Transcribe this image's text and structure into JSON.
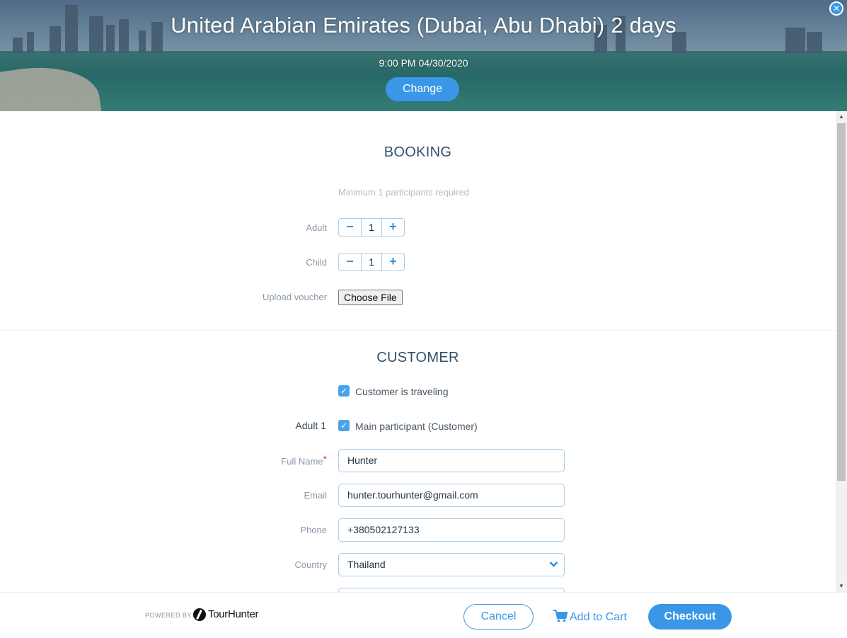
{
  "header": {
    "title": "United Arabian Emirates (Dubai, Abu Dhabi) 2 days",
    "datetime": "9:00 PM 04/30/2020",
    "change_label": "Change"
  },
  "booking": {
    "section_title": "BOOKING",
    "hint": "Minimum 1 participants required",
    "adult": {
      "label": "Adult",
      "value": "1",
      "minus": "−",
      "plus": "+"
    },
    "child": {
      "label": "Child",
      "value": "1",
      "minus": "−",
      "plus": "+"
    },
    "voucher": {
      "label": "Upload voucher",
      "button": "Choose File"
    }
  },
  "customer": {
    "section_title": "CUSTOMER",
    "traveling_label": "Customer is traveling",
    "traveling_checked": true,
    "participant_label": "Adult 1",
    "main_participant_label": "Main participant (Customer)",
    "main_participant_checked": true,
    "fields": {
      "full_name": {
        "label": "Full Name",
        "value": "Hunter",
        "required_mark": "*"
      },
      "email": {
        "label": "Email",
        "value": "hunter.tourhunter@gmail.com"
      },
      "phone": {
        "label": "Phone",
        "value": "+380502127133"
      },
      "country": {
        "label": "Country",
        "value": "Thailand"
      }
    }
  },
  "footer": {
    "powered_by": "POWERED BY",
    "brand": "TourHunter",
    "cancel_label": "Cancel",
    "add_to_cart_label": "Add to Cart",
    "checkout_label": "Checkout"
  },
  "colors": {
    "accent": "#3a97e8",
    "heading": "#34506b",
    "required": "#e2362f"
  },
  "icons": {
    "close": "close-icon",
    "check": "check-icon",
    "chevron": "chevron-down-icon",
    "cart": "cart-icon",
    "logo": "tourhunter-logo-icon"
  }
}
